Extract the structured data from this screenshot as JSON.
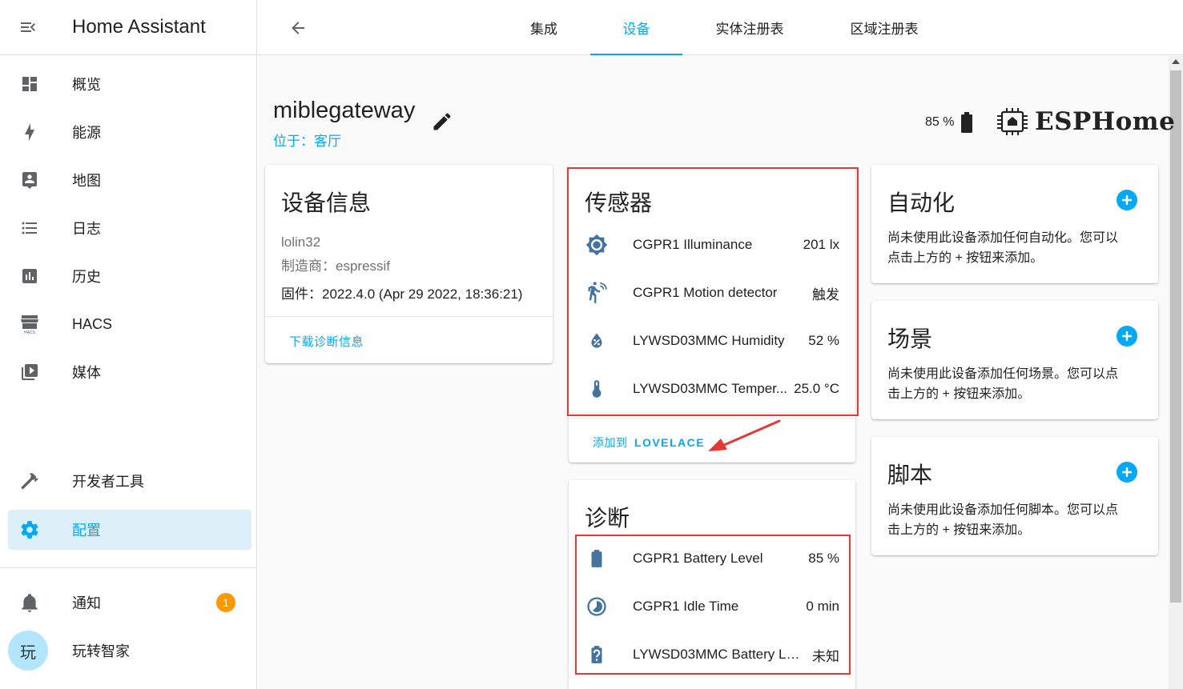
{
  "app": {
    "title": "Home Assistant"
  },
  "sidebar": {
    "items": [
      {
        "label": "概览",
        "icon": "dashboard-icon"
      },
      {
        "label": "能源",
        "icon": "lightning-icon"
      },
      {
        "label": "地图",
        "icon": "map-person-icon"
      },
      {
        "label": "日志",
        "icon": "list-icon"
      },
      {
        "label": "历史",
        "icon": "chart-bar-icon"
      },
      {
        "label": "HACS",
        "icon": "hacs-store-icon"
      },
      {
        "label": "媒体",
        "icon": "play-box-icon"
      }
    ],
    "dev_tools": "开发者工具",
    "config": "配置",
    "notifications": {
      "label": "通知",
      "count": "1"
    },
    "user": {
      "avatar_char": "玩",
      "name": "玩转智家"
    }
  },
  "tabs": [
    {
      "label": "集成",
      "active": false
    },
    {
      "label": "设备",
      "active": true
    },
    {
      "label": "实体注册表",
      "active": false
    },
    {
      "label": "区域注册表",
      "active": false
    }
  ],
  "device": {
    "name": "miblegateway",
    "area": "位于：客厅",
    "battery": "85 %",
    "brand": "ESPHome"
  },
  "device_info": {
    "title": "设备信息",
    "model": "lolin32",
    "manufacturer": "制造商：espressif",
    "firmware": "固件：2022.4.0 (Apr 29 2022, 18:36:21)",
    "download_label": "下载诊断信息"
  },
  "sensors": {
    "title": "传感器",
    "rows": [
      {
        "name": "CGPR1 Illuminance",
        "value": "201 lx",
        "icon": "brightness-icon"
      },
      {
        "name": "CGPR1 Motion detector",
        "value": "触发",
        "icon": "motion-sensor-icon"
      },
      {
        "name": "LYWSD03MMC Humidity",
        "value": "52 %",
        "icon": "water-percent-icon"
      },
      {
        "name": "LYWSD03MMC Temper...",
        "value": "25.0 °C",
        "icon": "thermometer-icon"
      }
    ],
    "add_label_cn": "添加到",
    "add_label_en": "LOVELACE"
  },
  "diagnostics": {
    "title": "诊断",
    "rows": [
      {
        "name": "CGPR1 Battery Level",
        "value": "85 %",
        "icon": "battery-icon"
      },
      {
        "name": "CGPR1 Idle Time",
        "value": "0 min",
        "icon": "timelapse-icon"
      },
      {
        "name": "LYWSD03MMC Battery Le...",
        "value": "未知",
        "icon": "battery-unknown-icon"
      }
    ]
  },
  "automation": {
    "title": "自动化",
    "desc1": "尚未使用此设备添加任何自动化。您可以",
    "desc2": "点击上方的 + 按钮来添加。"
  },
  "scene": {
    "title": "场景",
    "desc1": "尚未使用此设备添加任何场景。您可以点",
    "desc2": "击上方的 + 按钮来添加。"
  },
  "script": {
    "title": "脚本",
    "desc1": "尚未使用此设备添加任何脚本。您可以点",
    "desc2": "击上方的 + 按钮来添加。"
  },
  "colors": {
    "accent": "#03a9f4",
    "icon": "#44739e",
    "highlight": "#e53935",
    "badge": "#ff9800"
  }
}
